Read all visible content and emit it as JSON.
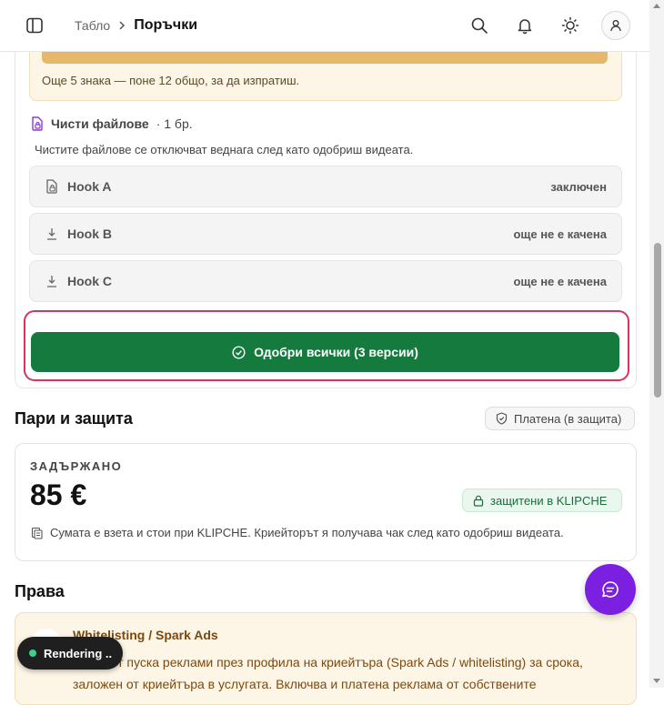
{
  "header": {
    "breadcrumb_parent": "Табло",
    "breadcrumb_separator": ">",
    "breadcrumb_current": "Поръчки",
    "icons": [
      "sidebar-toggle-icon",
      "search-icon",
      "bell-icon",
      "sun-icon",
      "user-icon"
    ]
  },
  "review": {
    "char_hint": "Още 5 знака — поне 12 общо, за да изпратиш.",
    "clean_files_label": "Чисти файлове",
    "clean_files_count": "· 1 бр.",
    "clean_files_desc": "Чистите файлове се отключват веднага след като одобриш видеата.",
    "files": [
      {
        "name": "Hook A",
        "status": "заключен",
        "icon": "lock-file-icon"
      },
      {
        "name": "Hook B",
        "status": "още не е качена",
        "icon": "download-icon"
      },
      {
        "name": "Hook C",
        "status": "още не е качена",
        "icon": "download-icon"
      }
    ],
    "approve_label": "Одобри всички (3 версии)"
  },
  "money": {
    "title": "Пари и защита",
    "paid_badge": "Платена (в защита)",
    "held_label": "ЗАДЪРЖАНО",
    "amount": "85 €",
    "protected_badge": "защитени в KLIPCHE",
    "note": "Сумата е взета и стои при KLIPCHE. Криейторът я получава чак след като одобриш видеата."
  },
  "rights": {
    "title": "Права",
    "item_title": "Whitelisting / Spark Ads",
    "item_text": "Брандът пуска реклами през профила на криейтъра (Spark Ads / whitelisting) за срока, заложен от криейтъра в услугата. Включва и платена реклама от собствените"
  },
  "toast": {
    "label": "Rendering .."
  },
  "colors": {
    "approve": "#157a3e",
    "highlight_border": "#d6335f",
    "chat_fab": "#7b1fe0",
    "warning_bg": "#fdf5e6"
  }
}
